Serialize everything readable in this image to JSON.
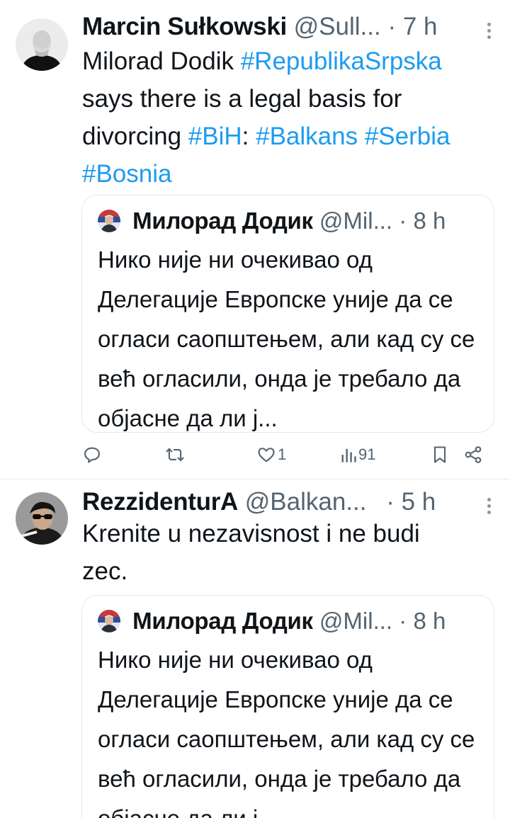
{
  "tweets": [
    {
      "author": "Marcin Sułkowski",
      "handle": "@Sull...",
      "dot": "·",
      "time": "7 h",
      "text_parts": [
        {
          "t": "Milorad Dodik ",
          "tag": false
        },
        {
          "t": "#RepublikaSrpska",
          "tag": true
        },
        {
          "t": " says there is a legal basis for divorcing ",
          "tag": false
        },
        {
          "t": "#BiH",
          "tag": true
        },
        {
          "t": ": ",
          "tag": false
        },
        {
          "t": "#Balkans",
          "tag": true
        },
        {
          "t": " ",
          "tag": false
        },
        {
          "t": "#Serbia",
          "tag": true
        },
        {
          "t": " ",
          "tag": false
        },
        {
          "t": "#Bosnia",
          "tag": true
        }
      ],
      "quote": {
        "author": "Милорад Додик",
        "handle": "@Mil...",
        "dot": "·",
        "time": "8 h",
        "text": "Нико није ни очекивао од Делегације Европске уније да се огласи саопштењем, али кад су се већ огласили, онда је требало да објасне да ли ј..."
      },
      "actions": {
        "reply_icon": "reply-icon",
        "retweet_icon": "retweet-icon",
        "like_icon": "heart-icon",
        "likes": "1",
        "views_icon": "views-icon",
        "views": "91",
        "bookmark_icon": "bookmark-icon",
        "share_icon": "share-icon"
      }
    },
    {
      "author": "RezzidenturA",
      "handle": "@Balkan...",
      "dot": "·",
      "time": "5 h",
      "text_parts": [
        {
          "t": "Krenite u nezavisnost  i ne budi zec.",
          "tag": false
        }
      ],
      "quote": {
        "author": "Милорад Додик",
        "handle": "@Mil...",
        "dot": "·",
        "time": "8 h",
        "text": "Нико није ни очекивао од Делегације Европске уније да се огласи саопштењем, али кад су се већ огласили, онда је требало да објасне да ли ј..."
      }
    }
  ],
  "colors": {
    "text": "#0f1419",
    "muted": "#536471",
    "link": "#1d9bf0",
    "border": "#e3e8ec"
  }
}
